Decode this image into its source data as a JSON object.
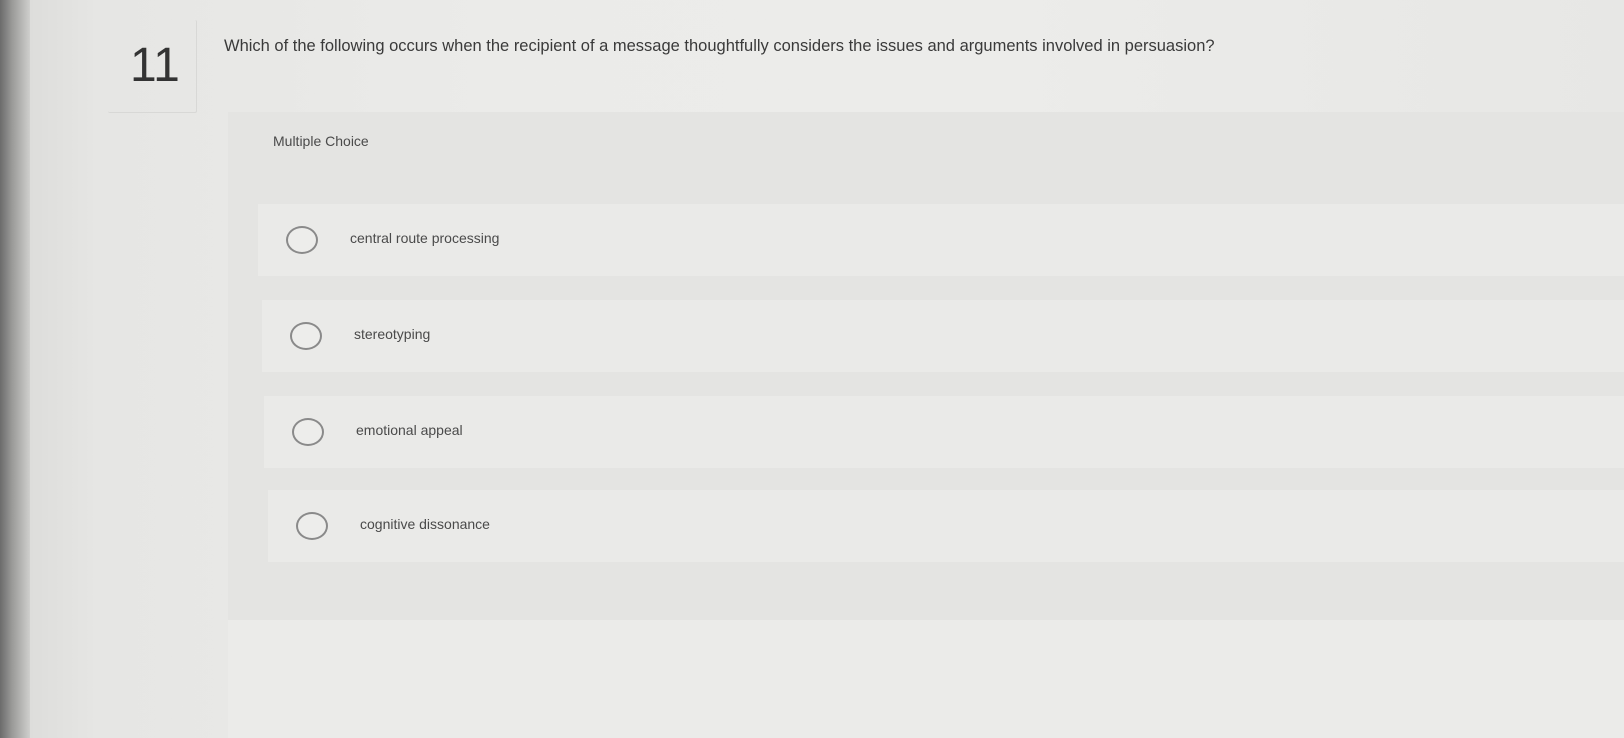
{
  "question": {
    "number": "11",
    "text": "Which of the following occurs when the recipient of a message thoughtfully considers the issues and arguments involved in persuasion?"
  },
  "panel": {
    "label": "Multiple Choice"
  },
  "options": [
    {
      "label": "central route processing",
      "selected": false
    },
    {
      "label": "stereotyping",
      "selected": false
    },
    {
      "label": "emotional appeal",
      "selected": false
    },
    {
      "label": "cognitive dissonance",
      "selected": false
    }
  ]
}
